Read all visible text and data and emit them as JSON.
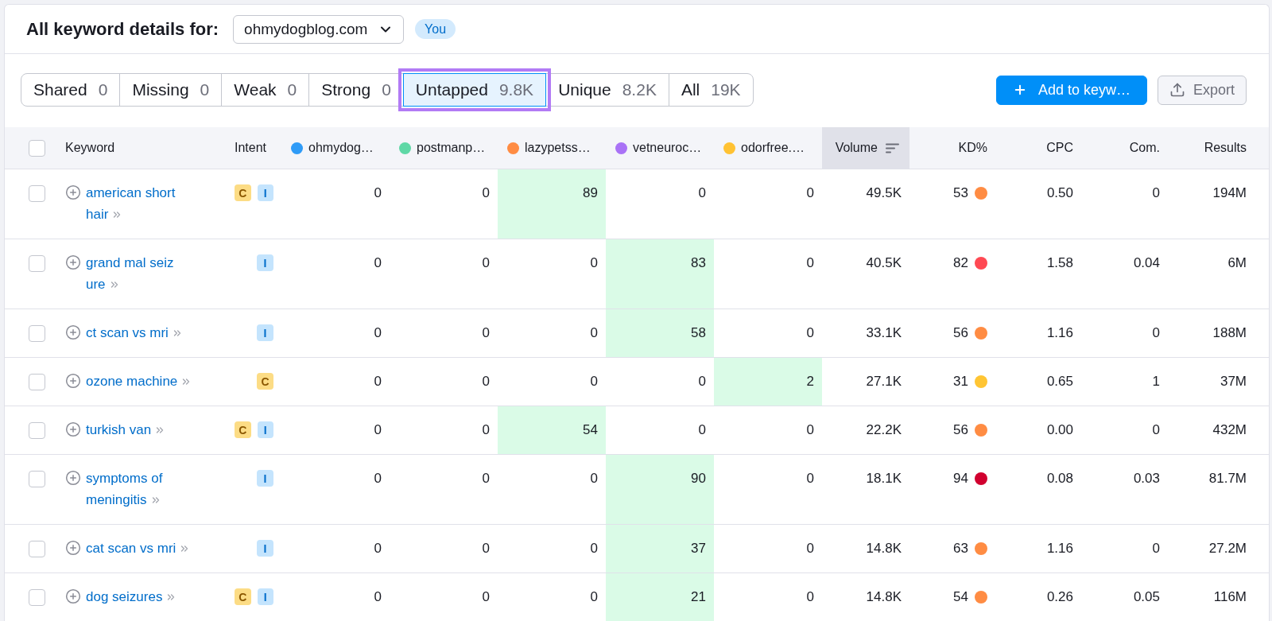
{
  "header": {
    "title": "All keyword details for:",
    "domain": "ohmydogblog.com",
    "badge": "You"
  },
  "tabs": [
    {
      "label": "Shared",
      "count": "0",
      "selected": false
    },
    {
      "label": "Missing",
      "count": "0",
      "selected": false
    },
    {
      "label": "Weak",
      "count": "0",
      "selected": false
    },
    {
      "label": "Strong",
      "count": "0",
      "selected": false
    },
    {
      "label": "Untapped",
      "count": "9.8K",
      "selected": true
    },
    {
      "label": "Unique",
      "count": "8.2K",
      "selected": false
    },
    {
      "label": "All",
      "count": "19K",
      "selected": false
    }
  ],
  "actions": [
    {
      "kind": "primary",
      "label": "Add to keyw…"
    },
    {
      "kind": "secondary",
      "label": "Export"
    }
  ],
  "table": {
    "select_all_checked": false,
    "columns": [
      {
        "label": "Keyword",
        "kind": "keyword"
      },
      {
        "label": "Intent",
        "kind": "intent"
      },
      {
        "label": "ohmydog…",
        "kind": "site",
        "color": "#2f9bf7"
      },
      {
        "label": "postmanp…",
        "kind": "site",
        "color": "#5fd8a6"
      },
      {
        "label": "lazypetss…",
        "kind": "site",
        "color": "#ff8c43"
      },
      {
        "label": "vetneuroc…",
        "kind": "site",
        "color": "#a972f6"
      },
      {
        "label": "odorfree.…",
        "kind": "site",
        "color": "#ffc233"
      },
      {
        "label": "Volume",
        "kind": "metric",
        "sorted": true
      },
      {
        "label": "KD%",
        "kind": "metric",
        "sorted": false
      },
      {
        "label": "CPC",
        "kind": "metric",
        "sorted": false
      },
      {
        "label": "Com.",
        "kind": "metric",
        "sorted": false
      },
      {
        "label": "Results",
        "kind": "metric",
        "sorted": false
      }
    ],
    "rows": [
      {
        "checked": false,
        "keyword": "american short hair",
        "intents": [
          {
            "label": "C",
            "kind": "commercial"
          },
          {
            "label": "I",
            "kind": "informational"
          }
        ],
        "positions": [
          {
            "value": "0",
            "highlighted": false
          },
          {
            "value": "0",
            "highlighted": false
          },
          {
            "value": "89",
            "highlighted": true
          },
          {
            "value": "0",
            "highlighted": false
          },
          {
            "value": "0",
            "highlighted": false
          }
        ],
        "metrics": [
          {
            "value": "49.5K"
          },
          {
            "value": "53",
            "color": "#ff8c43"
          },
          {
            "value": "0.50"
          },
          {
            "value": "0"
          },
          {
            "value": "194M"
          }
        ]
      },
      {
        "checked": false,
        "keyword": "grand mal seiz ure",
        "intents": [
          {
            "label": "I",
            "kind": "informational"
          }
        ],
        "positions": [
          {
            "value": "0",
            "highlighted": false
          },
          {
            "value": "0",
            "highlighted": false
          },
          {
            "value": "0",
            "highlighted": false
          },
          {
            "value": "83",
            "highlighted": true
          },
          {
            "value": "0",
            "highlighted": false
          }
        ],
        "metrics": [
          {
            "value": "40.5K"
          },
          {
            "value": "82",
            "color": "#ff4953"
          },
          {
            "value": "1.58"
          },
          {
            "value": "0.04"
          },
          {
            "value": "6M"
          }
        ]
      },
      {
        "checked": false,
        "keyword": "ct scan vs mri",
        "intents": [
          {
            "label": "I",
            "kind": "informational"
          }
        ],
        "positions": [
          {
            "value": "0",
            "highlighted": false
          },
          {
            "value": "0",
            "highlighted": false
          },
          {
            "value": "0",
            "highlighted": false
          },
          {
            "value": "58",
            "highlighted": true
          },
          {
            "value": "0",
            "highlighted": false
          }
        ],
        "metrics": [
          {
            "value": "33.1K"
          },
          {
            "value": "56",
            "color": "#ff8c43"
          },
          {
            "value": "1.16"
          },
          {
            "value": "0"
          },
          {
            "value": "188M"
          }
        ]
      },
      {
        "checked": false,
        "keyword": "ozone machine",
        "intents": [
          {
            "label": "C",
            "kind": "commercial"
          }
        ],
        "positions": [
          {
            "value": "0",
            "highlighted": false
          },
          {
            "value": "0",
            "highlighted": false
          },
          {
            "value": "0",
            "highlighted": false
          },
          {
            "value": "0",
            "highlighted": false
          },
          {
            "value": "2",
            "highlighted": true
          }
        ],
        "metrics": [
          {
            "value": "27.1K"
          },
          {
            "value": "31",
            "color": "#ffc533"
          },
          {
            "value": "0.65"
          },
          {
            "value": "1"
          },
          {
            "value": "37M"
          }
        ]
      },
      {
        "checked": false,
        "keyword": "turkish van",
        "intents": [
          {
            "label": "C",
            "kind": "commercial"
          },
          {
            "label": "I",
            "kind": "informational"
          }
        ],
        "positions": [
          {
            "value": "0",
            "highlighted": false
          },
          {
            "value": "0",
            "highlighted": false
          },
          {
            "value": "54",
            "highlighted": true
          },
          {
            "value": "0",
            "highlighted": false
          },
          {
            "value": "0",
            "highlighted": false
          }
        ],
        "metrics": [
          {
            "value": "22.2K"
          },
          {
            "value": "56",
            "color": "#ff8c43"
          },
          {
            "value": "0.00"
          },
          {
            "value": "0"
          },
          {
            "value": "432M"
          }
        ]
      },
      {
        "checked": false,
        "keyword": "symptoms of meningitis",
        "intents": [
          {
            "label": "I",
            "kind": "informational"
          }
        ],
        "positions": [
          {
            "value": "0",
            "highlighted": false
          },
          {
            "value": "0",
            "highlighted": false
          },
          {
            "value": "0",
            "highlighted": false
          },
          {
            "value": "90",
            "highlighted": true
          },
          {
            "value": "0",
            "highlighted": false
          }
        ],
        "metrics": [
          {
            "value": "18.1K"
          },
          {
            "value": "94",
            "color": "#d1002f"
          },
          {
            "value": "0.08"
          },
          {
            "value": "0.03"
          },
          {
            "value": "81.7M"
          }
        ]
      },
      {
        "checked": false,
        "keyword": "cat scan vs mri",
        "intents": [
          {
            "label": "I",
            "kind": "informational"
          }
        ],
        "positions": [
          {
            "value": "0",
            "highlighted": false
          },
          {
            "value": "0",
            "highlighted": false
          },
          {
            "value": "0",
            "highlighted": false
          },
          {
            "value": "37",
            "highlighted": true
          },
          {
            "value": "0",
            "highlighted": false
          }
        ],
        "metrics": [
          {
            "value": "14.8K"
          },
          {
            "value": "63",
            "color": "#ff8c43"
          },
          {
            "value": "1.16"
          },
          {
            "value": "0"
          },
          {
            "value": "27.2M"
          }
        ]
      },
      {
        "checked": false,
        "keyword": "dog seizures",
        "intents": [
          {
            "label": "C",
            "kind": "commercial"
          },
          {
            "label": "I",
            "kind": "informational"
          }
        ],
        "positions": [
          {
            "value": "0",
            "highlighted": false
          },
          {
            "value": "0",
            "highlighted": false
          },
          {
            "value": "0",
            "highlighted": false
          },
          {
            "value": "21",
            "highlighted": true
          },
          {
            "value": "0",
            "highlighted": false
          }
        ],
        "metrics": [
          {
            "value": "14.8K"
          },
          {
            "value": "54",
            "color": "#ff8c43"
          },
          {
            "value": "0.26"
          },
          {
            "value": "0.05"
          },
          {
            "value": "116M"
          }
        ]
      }
    ]
  }
}
